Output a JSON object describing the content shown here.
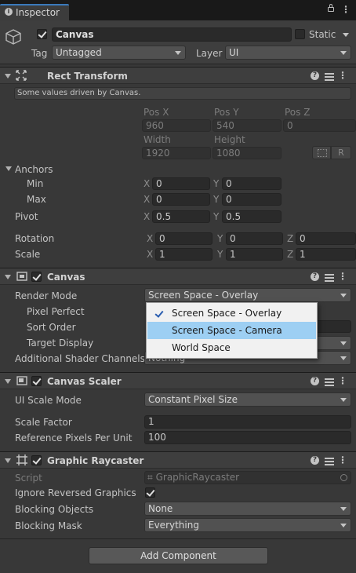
{
  "tab": {
    "title": "Inspector"
  },
  "object": {
    "active": true,
    "name": "Canvas",
    "static_label": "Static",
    "tag_label": "Tag",
    "tag_value": "Untagged",
    "layer_label": "Layer",
    "layer_value": "UI"
  },
  "rect_transform": {
    "title": "Rect Transform",
    "note": "Some values driven by Canvas.",
    "pos_x_label": "Pos X",
    "pos_y_label": "Pos Y",
    "pos_z_label": "Pos Z",
    "pos_x": "960",
    "pos_y": "540",
    "pos_z": "0",
    "width_label": "Width",
    "height_label": "Height",
    "width": "1920",
    "height": "1080",
    "r_button": "R",
    "anchors_label": "Anchors",
    "min_label": "Min",
    "max_label": "Max",
    "min_x": "0",
    "min_y": "0",
    "max_x": "0",
    "max_y": "0",
    "pivot_label": "Pivot",
    "pivot_x": "0.5",
    "pivot_y": "0.5",
    "rotation_label": "Rotation",
    "rot_x": "0",
    "rot_y": "0",
    "rot_z": "0",
    "scale_label": "Scale",
    "scale_x": "1",
    "scale_y": "1",
    "scale_z": "1",
    "x": "X",
    "y": "Y",
    "z": "Z"
  },
  "canvas": {
    "title": "Canvas",
    "enabled": true,
    "render_mode_label": "Render Mode",
    "render_mode_value": "Screen Space - Overlay",
    "pixel_perfect_label": "Pixel Perfect",
    "sort_order_label": "Sort Order",
    "target_display_label": "Target Display",
    "shader_channels_label": "Additional Shader Channels",
    "shader_channels_value": "Nothing"
  },
  "dropdown_menu": {
    "options": [
      "Screen Space - Overlay",
      "Screen Space - Camera",
      "World Space"
    ],
    "checked_index": 0,
    "highlighted_index": 1
  },
  "canvas_scaler": {
    "title": "Canvas Scaler",
    "enabled": true,
    "ui_scale_mode_label": "UI Scale Mode",
    "ui_scale_mode_value": "Constant Pixel Size",
    "scale_factor_label": "Scale Factor",
    "scale_factor_value": "1",
    "ref_ppu_label": "Reference Pixels Per Unit",
    "ref_ppu_value": "100"
  },
  "graphic_raycaster": {
    "title": "Graphic Raycaster",
    "enabled": true,
    "script_label": "Script",
    "script_value": "GraphicRaycaster",
    "ignore_reversed_label": "Ignore Reversed Graphics",
    "ignore_reversed_value": true,
    "blocking_objects_label": "Blocking Objects",
    "blocking_objects_value": "None",
    "blocking_mask_label": "Blocking Mask",
    "blocking_mask_value": "Everything"
  },
  "add_component": {
    "label": "Add Component"
  }
}
